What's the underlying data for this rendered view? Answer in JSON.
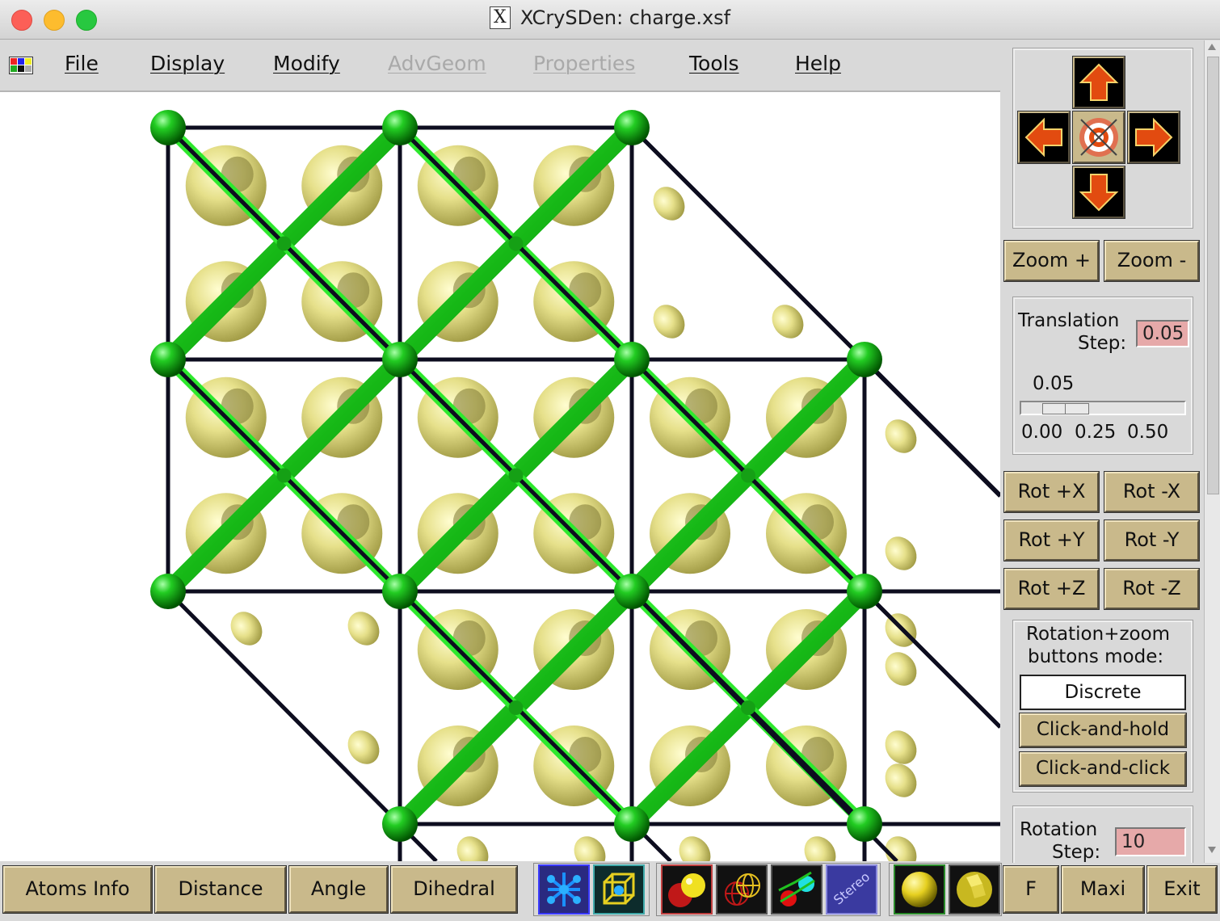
{
  "window": {
    "title": "XCrySDen: charge.xsf"
  },
  "menu": {
    "items": [
      {
        "label": "File",
        "enabled": true
      },
      {
        "label": "Display",
        "enabled": true
      },
      {
        "label": "Modify",
        "enabled": true
      },
      {
        "label": "AdvGeom",
        "enabled": false
      },
      {
        "label": "Properties",
        "enabled": false
      },
      {
        "label": "Tools",
        "enabled": true
      },
      {
        "label": "Help",
        "enabled": true
      }
    ]
  },
  "nav": {
    "up_icon": "arrow-up-icon",
    "down_icon": "arrow-down-icon",
    "left_icon": "arrow-left-icon",
    "right_icon": "arrow-right-icon",
    "center_icon": "target-icon"
  },
  "zoom": {
    "plus_label": "Zoom +",
    "minus_label": "Zoom -"
  },
  "translation": {
    "label_line1": "Translation",
    "label_line2": "Step:",
    "value": "0.05",
    "slider_value": "0.05",
    "slider_fraction": 0.1,
    "ticks": [
      "0.00",
      "0.25",
      "0.50"
    ]
  },
  "rotation_buttons": [
    {
      "plus": "Rot +X",
      "minus": "Rot -X"
    },
    {
      "plus": "Rot +Y",
      "minus": "Rot -Y"
    },
    {
      "plus": "Rot +Z",
      "minus": "Rot -Z"
    }
  ],
  "mode": {
    "label_line1": "Rotation+zoom",
    "label_line2": "buttons mode:",
    "selected": "Discrete",
    "option2": "Click-and-hold",
    "option3": "Click-and-click"
  },
  "rotation_step": {
    "label_line1": "Rotation",
    "label_line2": "Step:",
    "value": "10"
  },
  "bottom": {
    "atoms_info": "Atoms Info",
    "distance": "Distance",
    "angle": "Angle",
    "dihedral": "Dihedral",
    "stereo_label": "Stereo",
    "f": "F",
    "maxi": "Maxi",
    "exit": "Exit"
  },
  "colors": {
    "atom_green": "#1fbf1f",
    "isosurface_yellow": "#dcd77a",
    "cell_edges": "#0d0d1f",
    "button_tan": "#c9b98b",
    "entry_pink": "#e6a9a9"
  }
}
